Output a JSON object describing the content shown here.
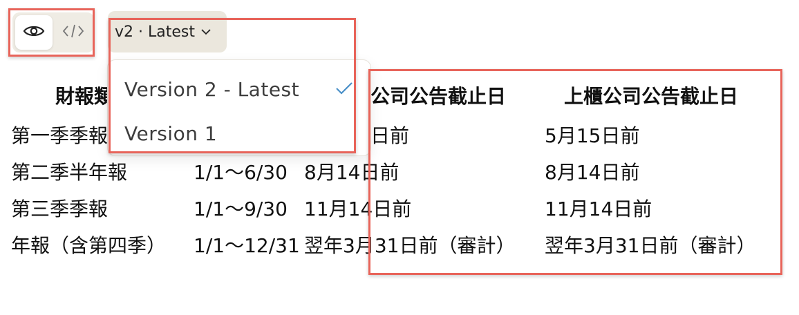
{
  "toolbar": {
    "preview_icon": "eye-icon",
    "code_icon": "code-icon",
    "version_label": "v2 · Latest",
    "chevron_icon": "chevron-down-icon"
  },
  "dropdown": {
    "items": [
      {
        "label": "Version 2 - Latest",
        "selected": true
      },
      {
        "label": "Version 1",
        "selected": false
      }
    ],
    "check_icon": "check-icon",
    "check_color": "#4a90c8"
  },
  "highlight_color": "#e8645a",
  "table": {
    "headers": [
      "財報類",
      "公司公告截止日",
      "上櫃公司公告截止日"
    ],
    "rows": [
      {
        "label": "第一季季報",
        "c2": "日前",
        "c3": "5月15日前"
      },
      {
        "label": "第二季半年報",
        "period": "1/1～6/30",
        "c2": "8月14日前",
        "c3": "8月14日前"
      },
      {
        "label": "第三季季報",
        "period": "1/1～9/30",
        "c2": "11月14日前",
        "c3": "11月14日前"
      },
      {
        "label": "年報（含第四季）",
        "period": "1/1～12/31",
        "c2": "翌年3月31日前（審計）",
        "c3": "翌年3月31日前（審計）"
      }
    ]
  }
}
